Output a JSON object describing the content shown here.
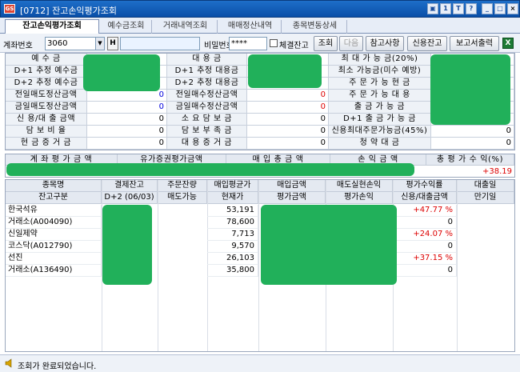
{
  "window": {
    "title": "[0712] 잔고손익평가조회",
    "app_icon": "GS",
    "controls": [
      "▣",
      "1",
      "T",
      "?",
      "_",
      "□",
      "×"
    ]
  },
  "tabs": [
    {
      "label": "잔고손익평가조회",
      "active": true
    },
    {
      "label": "예수금조회",
      "active": false
    },
    {
      "label": "거래내역조회",
      "active": false
    },
    {
      "label": "매매정산내역",
      "active": false
    },
    {
      "label": "종목변동상세",
      "active": false
    }
  ],
  "toolbar": {
    "account_label": "계좌번호",
    "account_value": "3060",
    "h_button": "H",
    "password_label": "비밀번호",
    "password_value": "****",
    "checkbox_label": "체결잔고",
    "query_button": "조회",
    "next_button": "다음",
    "reference_button": "참고사항",
    "credit_button": "신용잔고",
    "report_button": "보고서출력",
    "excel_icon": "X"
  },
  "summary": {
    "col1": [
      {
        "label": "예 수 금",
        "value": ""
      },
      {
        "label": "D+1 추정 예수금",
        "value": ""
      },
      {
        "label": "D+2 추정 예수금",
        "value": ""
      },
      {
        "label": "전일매도정산금액",
        "value": "0"
      },
      {
        "label": "금일매도정산금액",
        "value": "0"
      },
      {
        "label": "신 용/대 출 금액",
        "value": "0"
      },
      {
        "label": "담 보 비 율",
        "value": "0"
      },
      {
        "label": "현 금 증 거 금",
        "value": "0"
      }
    ],
    "col2": [
      {
        "label": "대 용 금",
        "value": ""
      },
      {
        "label": "D+1 추정 대용금",
        "value": ""
      },
      {
        "label": "D+2 추정 대용금",
        "value": ""
      },
      {
        "label": "전일매수정산금액",
        "value": "0"
      },
      {
        "label": "금일매수정산금액",
        "value": "0"
      },
      {
        "label": "소 요 담 보 금",
        "value": "0"
      },
      {
        "label": "담 보 부 족 금",
        "value": "0"
      },
      {
        "label": "대 용 증 거 금",
        "value": "0"
      }
    ],
    "col3": [
      {
        "label": "최 대 가 능 금(20%)",
        "value": ""
      },
      {
        "label": "최소 가능금(미수 예방)",
        "value": ""
      },
      {
        "label": "주 문 가 능 현 금",
        "value": ""
      },
      {
        "label": "주 문 가 능 대 용",
        "value": ""
      },
      {
        "label": "출 금 가 능 금",
        "value": ""
      },
      {
        "label": "D+1 출 금 가 능 금",
        "value": ""
      },
      {
        "label": "신용최대주문가능금(45%)",
        "value": "0"
      },
      {
        "label": "청 약 대 금",
        "value": "0"
      }
    ]
  },
  "totals": {
    "headers": [
      "계 좌 평 가 금 액",
      "유가증권평가금액",
      "매 입 총 금 액",
      "손 익 금 액",
      "총 평 가 수 익(%)"
    ],
    "return_value": "+38.19"
  },
  "holdings": {
    "header_row1": [
      "종목명",
      "결제잔고",
      "주문잔량",
      "매입평균가",
      "매입금액",
      "매도실현손익",
      "평가수익률",
      "대출일"
    ],
    "header_row2": [
      "잔고구분",
      "D+2 (06/03)",
      "매도가능",
      "현재가",
      "평가금액",
      "평가손익",
      "신용/대출금액",
      "만기일"
    ],
    "rows": [
      {
        "name": "한국석유",
        "price": "53,191",
        "rate": "+47.77 %"
      },
      {
        "name": "거래소(A004090)",
        "price": "78,600",
        "rate": "0"
      },
      {
        "name": "신일제약",
        "price": "7,713",
        "rate": "+24.07 %"
      },
      {
        "name": "코스닥(A012790)",
        "price": "9,570",
        "rate": "0"
      },
      {
        "name": "선진",
        "price": "26,103",
        "rate": "+37.15 %"
      },
      {
        "name": "거래소(A136490)",
        "price": "35,800",
        "rate": "0"
      }
    ]
  },
  "status": {
    "message": "조회가 완료되었습니다.",
    "icon": "speaker-icon"
  },
  "colors": {
    "titlebar": "#1e6ec8",
    "positive": "#dd0000",
    "zero_value": "#0000dd",
    "redaction": "#21b05a"
  }
}
